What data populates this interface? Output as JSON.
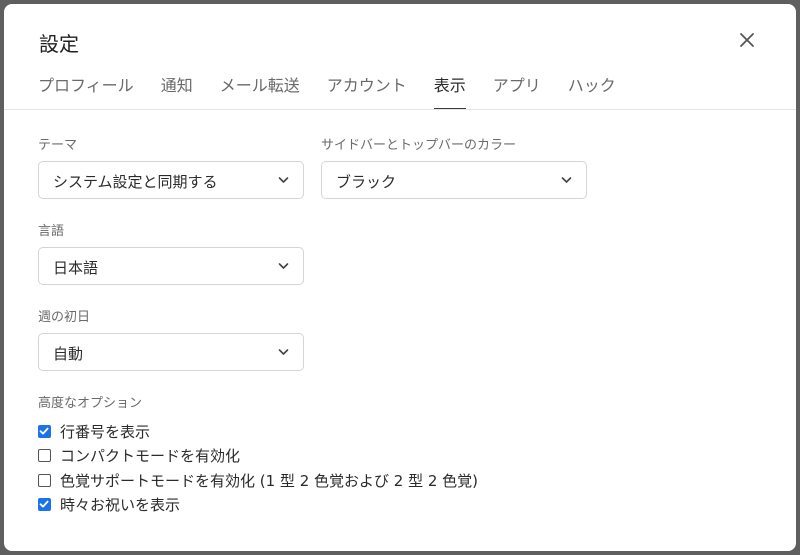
{
  "dialog": {
    "title": "設定"
  },
  "tabs": [
    {
      "label": "プロフィール"
    },
    {
      "label": "通知"
    },
    {
      "label": "メール転送"
    },
    {
      "label": "アカウント"
    },
    {
      "label": "表示",
      "active": true
    },
    {
      "label": "アプリ"
    },
    {
      "label": "ハック"
    }
  ],
  "fields": {
    "theme": {
      "label": "テーマ",
      "value": "システム設定と同期する"
    },
    "bar_color": {
      "label": "サイドバーとトップバーのカラー",
      "value": "ブラック"
    },
    "language": {
      "label": "言語",
      "value": "日本語"
    },
    "week_start": {
      "label": "週の初日",
      "value": "自動"
    }
  },
  "advanced": {
    "label": "高度なオプション",
    "options": [
      {
        "label": "行番号を表示",
        "checked": true
      },
      {
        "label": "コンパクトモードを有効化",
        "checked": false
      },
      {
        "label": "色覚サポートモードを有効化 (1 型 2 色覚および 2 型 2 色覚)",
        "checked": false
      },
      {
        "label": "時々お祝いを表示",
        "checked": true
      }
    ]
  },
  "colors": {
    "accent": "#1a73e8",
    "backdrop": "#5f5f5f"
  },
  "icons": {
    "close": "close-icon",
    "dropdown": "chevron-down-icon",
    "check": "check-icon"
  }
}
